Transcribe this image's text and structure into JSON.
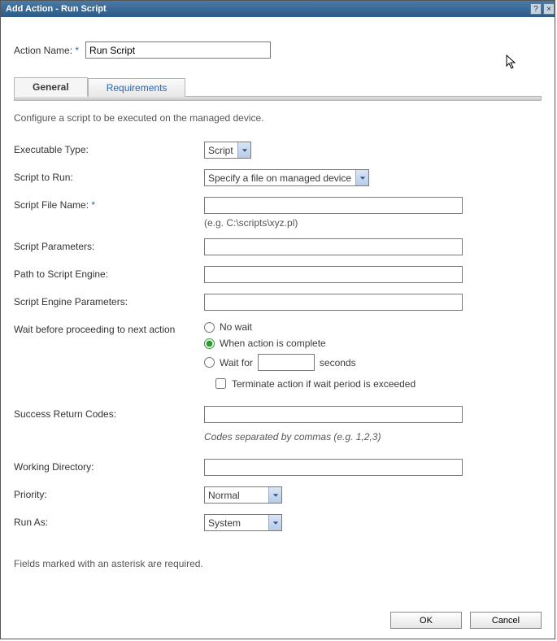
{
  "titlebar": {
    "title": "Add Action - Run Script",
    "help_label": "?",
    "close_label": "×"
  },
  "action_name": {
    "label": "Action Name:",
    "required_mark": "*",
    "value": "Run Script"
  },
  "tabs": {
    "general": "General",
    "requirements": "Requirements"
  },
  "description": "Configure a script to be executed on the managed device.",
  "fields": {
    "executable_type": {
      "label": "Executable Type:",
      "value": "Script"
    },
    "script_to_run": {
      "label": "Script to Run:",
      "value": "Specify a file on managed device"
    },
    "script_file_name": {
      "label": "Script File Name:",
      "required_mark": "*",
      "value": "",
      "hint": "(e.g. C:\\scripts\\xyz.pl)"
    },
    "script_parameters": {
      "label": "Script Parameters:",
      "value": ""
    },
    "path_to_engine": {
      "label": "Path to Script Engine:",
      "value": ""
    },
    "engine_parameters": {
      "label": "Script Engine Parameters:",
      "value": ""
    },
    "wait": {
      "label": "Wait before proceeding to next action",
      "no_wait": "No wait",
      "when_complete": "When action is complete",
      "wait_for_pre": "Wait for",
      "wait_for_seconds_value": "",
      "wait_for_post": "seconds",
      "terminate": "Terminate action if wait period is exceeded",
      "selected": "when_complete"
    },
    "success_return_codes": {
      "label": "Success Return Codes:",
      "value": "",
      "hint": "Codes separated by commas (e.g. 1,2,3)"
    },
    "working_directory": {
      "label": "Working Directory:",
      "value": ""
    },
    "priority": {
      "label": "Priority:",
      "value": "Normal"
    },
    "run_as": {
      "label": "Run As:",
      "value": "System"
    }
  },
  "footnote": "Fields marked with an asterisk are required.",
  "buttons": {
    "ok": "OK",
    "cancel": "Cancel"
  }
}
